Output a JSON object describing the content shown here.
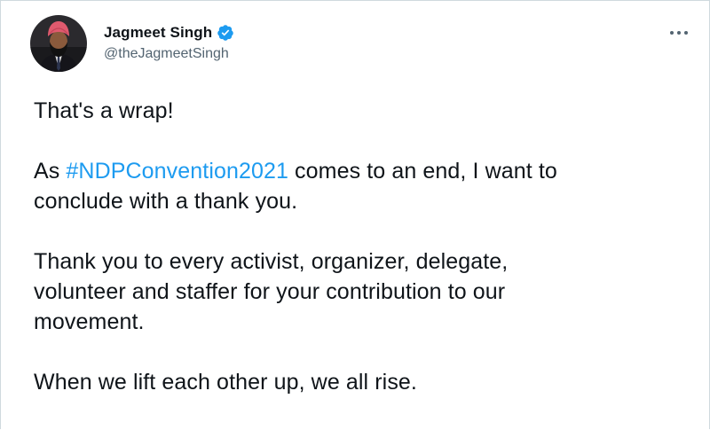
{
  "author": {
    "display_name": "Jagmeet Singh",
    "handle": "@theJagmeetSingh",
    "verified": true,
    "avatar_icon": "avatar-photo",
    "verified_icon": "verified-badge-icon"
  },
  "menu": {
    "icon": "more-options-icon"
  },
  "tweet": {
    "p1": "That's a wrap!",
    "p2_prefix": "As ",
    "p2_hashtag": "#NDPConvention2021",
    "p2_line1_suffix": " comes to an end, I want to",
    "p2_line2": "conclude with a thank you.",
    "p3_line1": "Thank you to every activist, organizer, delegate,",
    "p3_line2": "volunteer and staffer for your contribution to our",
    "p3_line3": "movement.",
    "p4": "When we lift each other up, we all rise."
  },
  "colors": {
    "link": "#1d9bf0",
    "text": "#0f1419",
    "secondary": "#536471",
    "turban": "#e05a6e"
  }
}
